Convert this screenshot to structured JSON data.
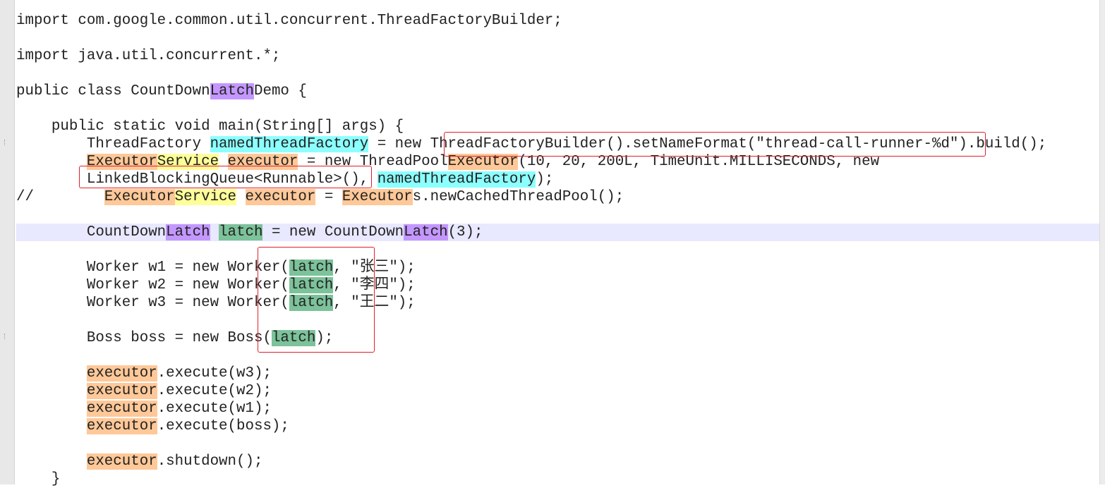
{
  "code_lines": [
    {
      "segments": [
        {
          "t": "import com.google.common.util.concurrent.ThreadFactoryBuilder;"
        }
      ]
    },
    {
      "segments": [
        {
          "t": ""
        }
      ]
    },
    {
      "segments": [
        {
          "t": "import java.util.concurrent.*;"
        }
      ]
    },
    {
      "segments": [
        {
          "t": ""
        }
      ]
    },
    {
      "segments": [
        {
          "t": "public class CountDown"
        },
        {
          "t": "Latch",
          "hl": "purple",
          "name": "latch-occurrence"
        },
        {
          "t": "Demo {"
        }
      ]
    },
    {
      "segments": [
        {
          "t": ""
        }
      ]
    },
    {
      "segments": [
        {
          "t": "    public static void main(String[] args) {"
        }
      ]
    },
    {
      "segments": [
        {
          "t": "        ThreadFactory "
        },
        {
          "t": "namedThreadFactory",
          "hl": "cyan",
          "name": "namedThreadFactory-occurrence"
        },
        {
          "t": " = new ThreadFactoryBuilder().setNameFormat(\"thread-call-runner-%d\").build();"
        }
      ]
    },
    {
      "segments": [
        {
          "t": "        "
        },
        {
          "t": "Executor",
          "hl": "orange",
          "name": "executor-type-occurrence"
        },
        {
          "t": "Service",
          "hl": "yellow",
          "name": "service-type-occurrence"
        },
        {
          "t": " "
        },
        {
          "t": "executor",
          "hl": "orange",
          "name": "executor-variable-occurrence"
        },
        {
          "t": " = new ThreadPool"
        },
        {
          "t": "Executor",
          "hl": "orange",
          "name": "executor-type-occurrence"
        },
        {
          "t": "(10, 20, 200L, TimeUnit.MILLISECONDS, new"
        }
      ]
    },
    {
      "segments": [
        {
          "t": "        LinkedBlockingQueue<Runnable>(), "
        },
        {
          "t": "namedThreadFactory",
          "hl": "cyan",
          "name": "namedThreadFactory-occurrence"
        },
        {
          "t": ");"
        }
      ]
    },
    {
      "segments": [
        {
          "t": "//        "
        },
        {
          "t": "Executor",
          "hl": "orange",
          "name": "executor-type-occurrence"
        },
        {
          "t": "Service",
          "hl": "yellow",
          "name": "service-type-occurrence"
        },
        {
          "t": " "
        },
        {
          "t": "executor",
          "hl": "orange",
          "name": "executor-variable-occurrence"
        },
        {
          "t": " = "
        },
        {
          "t": "Executor",
          "hl": "orange",
          "name": "executor-type-occurrence"
        },
        {
          "t": "s.newCachedThreadPool();"
        }
      ]
    },
    {
      "segments": [
        {
          "t": ""
        }
      ]
    },
    {
      "current": true,
      "segments": [
        {
          "t": "        CountDown"
        },
        {
          "t": "Latch",
          "hl": "purple",
          "name": "latch-occurrence"
        },
        {
          "t": " "
        },
        {
          "t": "latch",
          "hl": "green",
          "name": "latch-variable-occurrence"
        },
        {
          "t": " = new CountDown"
        },
        {
          "t": "Latch",
          "hl": "purple",
          "name": "latch-occurrence"
        },
        {
          "t": "(3);"
        }
      ]
    },
    {
      "segments": [
        {
          "t": ""
        }
      ]
    },
    {
      "segments": [
        {
          "t": "        Worker w1 = new Worker("
        },
        {
          "t": "latch",
          "hl": "green",
          "name": "latch-variable-occurrence"
        },
        {
          "t": ", \"张三\");"
        }
      ]
    },
    {
      "segments": [
        {
          "t": "        Worker w2 = new Worker("
        },
        {
          "t": "latch",
          "hl": "green",
          "name": "latch-variable-occurrence"
        },
        {
          "t": ", \"李四\");"
        }
      ]
    },
    {
      "segments": [
        {
          "t": "        Worker w3 = new Worker("
        },
        {
          "t": "latch",
          "hl": "green",
          "name": "latch-variable-occurrence"
        },
        {
          "t": ", \"王二\");"
        }
      ]
    },
    {
      "segments": [
        {
          "t": ""
        }
      ]
    },
    {
      "segments": [
        {
          "t": "        Boss boss = new Boss("
        },
        {
          "t": "latch",
          "hl": "green",
          "name": "latch-variable-occurrence"
        },
        {
          "t": ");"
        }
      ]
    },
    {
      "segments": [
        {
          "t": ""
        }
      ]
    },
    {
      "segments": [
        {
          "t": "        "
        },
        {
          "t": "executor",
          "hl": "orange",
          "name": "executor-variable-occurrence"
        },
        {
          "t": ".execute(w3);"
        }
      ]
    },
    {
      "segments": [
        {
          "t": "        "
        },
        {
          "t": "executor",
          "hl": "orange",
          "name": "executor-variable-occurrence"
        },
        {
          "t": ".execute(w2);"
        }
      ]
    },
    {
      "segments": [
        {
          "t": "        "
        },
        {
          "t": "executor",
          "hl": "orange",
          "name": "executor-variable-occurrence"
        },
        {
          "t": ".execute(w1);"
        }
      ]
    },
    {
      "segments": [
        {
          "t": "        "
        },
        {
          "t": "executor",
          "hl": "orange",
          "name": "executor-variable-occurrence"
        },
        {
          "t": ".execute(boss);"
        }
      ]
    },
    {
      "segments": [
        {
          "t": ""
        }
      ]
    },
    {
      "segments": [
        {
          "t": "        "
        },
        {
          "t": "executor",
          "hl": "orange",
          "name": "executor-variable-occurrence"
        },
        {
          "t": ".shutdown();"
        }
      ]
    },
    {
      "segments": [
        {
          "t": "    }"
        }
      ]
    }
  ],
  "colors": {
    "highlight_purple": "#c397ff",
    "highlight_cyan": "#8cffff",
    "highlight_orange": "#ffc898",
    "highlight_yellow": "#ffff99",
    "highlight_green": "#7cc29a",
    "current_line": "#e8e8ff",
    "annotation_box": "#e0202a"
  }
}
